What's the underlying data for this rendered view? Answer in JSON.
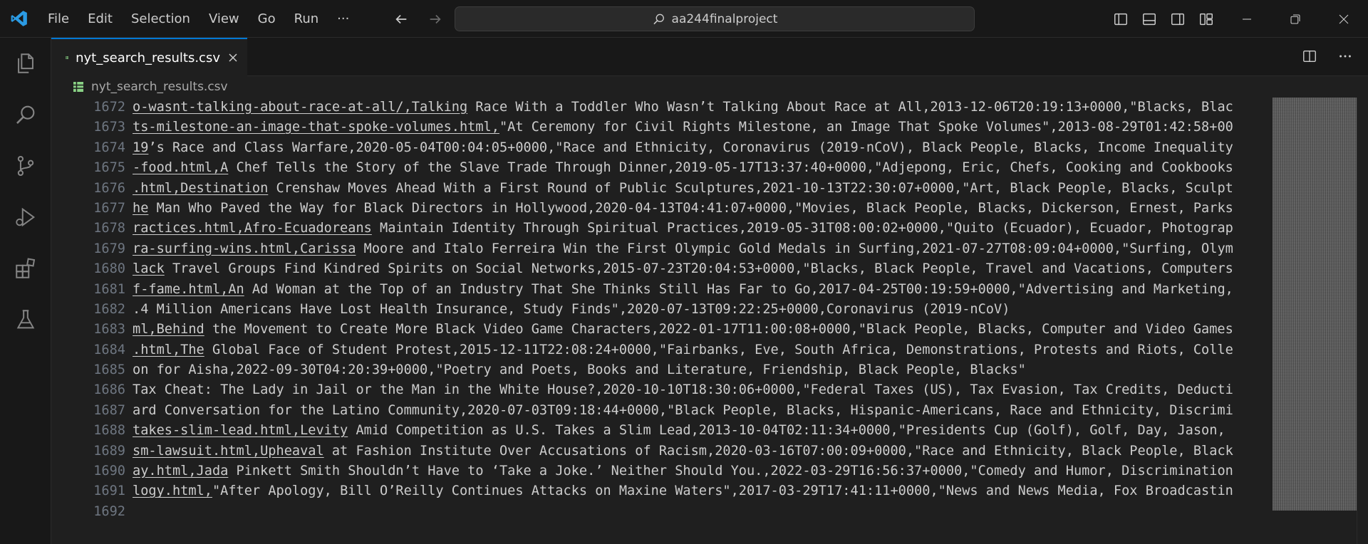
{
  "titlebar": {
    "menu": [
      "File",
      "Edit",
      "Selection",
      "View",
      "Go",
      "Run",
      "···"
    ],
    "search_text": "aa244finalproject"
  },
  "tab": {
    "label": "nyt_search_results.csv"
  },
  "breadcrumb": {
    "file": "nyt_search_results.csv"
  },
  "editor": {
    "lines": [
      {
        "n": "1672",
        "link": "o-wasnt-talking-about-race-at-all/,Talking",
        "rest": " Race With a Toddler Who Wasn’t Talking About Race at All,2013-12-06T20:19:13+0000,\"Blacks, Blac"
      },
      {
        "n": "1673",
        "link": "ts-milestone-an-image-that-spoke-volumes.html,",
        "rest": "\"At Ceremony for Civil Rights Milestone, an Image That Spoke Volumes\",2013-08-29T01:42:58+00"
      },
      {
        "n": "1674",
        "link": "19",
        "rest": "’s Race and Class Warfare,2020-05-04T00:04:05+0000,\"Race and Ethnicity, Coronavirus (2019-nCoV), Black People, Blacks, Income Inequality"
      },
      {
        "n": "1675",
        "link": "-food.html,A",
        "rest": " Chef Tells the Story of the Slave Trade Through Dinner,2019-05-17T13:37:40+0000,\"Adjepong, Eric, Chefs, Cooking and Cookbooks"
      },
      {
        "n": "1676",
        "link": ".html,Destination",
        "rest": " Crenshaw Moves Ahead With a First Round of Public Sculptures,2021-10-13T22:30:07+0000,\"Art, Black People, Blacks, Sculpt"
      },
      {
        "n": "1677",
        "link": "he",
        "rest": " Man Who Paved the Way for Black Directors in Hollywood,2020-04-13T04:41:07+0000,\"Movies, Black People, Blacks, Dickerson, Ernest, Parks"
      },
      {
        "n": "1678",
        "link": "ractices.html,Afro-Ecuadoreans",
        "rest": " Maintain Identity Through Spiritual Practices,2019-05-31T08:00:02+0000,\"Quito (Ecuador), Ecuador, Photograp"
      },
      {
        "n": "1679",
        "link": "ra-surfing-wins.html,Carissa",
        "rest": " Moore and Italo Ferreira Win the First Olympic Gold Medals in Surfing,2021-07-27T08:09:04+0000,\"Surfing, Olym"
      },
      {
        "n": "1680",
        "link": "lack",
        "rest": " Travel Groups Find Kindred Spirits on Social Networks,2015-07-23T20:04:53+0000,\"Blacks, Black People, Travel and Vacations, Computers"
      },
      {
        "n": "1681",
        "link": "f-fame.html,An",
        "rest": " Ad Woman at the Top of an Industry That She Thinks Still Has Far to Go,2017-04-25T00:19:59+0000,\"Advertising and Marketing,"
      },
      {
        "n": "1682",
        "link": "",
        "rest": ".4 Million Americans Have Lost Health Insurance, Study Finds\",2020-07-13T09:22:25+0000,Coronavirus (2019-nCoV)"
      },
      {
        "n": "1683",
        "link": "ml,Behind",
        "rest": " the Movement to Create More Black Video Game Characters,2022-01-17T11:00:08+0000,\"Black People, Blacks, Computer and Video Games"
      },
      {
        "n": "1684",
        "link": ".html,The",
        "rest": " Global Face of Student Protest,2015-12-11T22:08:24+0000,\"Fairbanks, Eve, South Africa, Demonstrations, Protests and Riots, Colle"
      },
      {
        "n": "1685",
        "link": "",
        "rest": "on for Aisha,2022-09-30T04:20:39+0000,\"Poetry and Poets, Books and Literature, Friendship, Black People, Blacks\""
      },
      {
        "n": "1686",
        "link": "",
        "rest": "Tax Cheat: The Lady in Jail or the Man in the White House?,2020-10-10T18:30:06+0000,\"Federal Taxes (US), Tax Evasion, Tax Credits, Deducti"
      },
      {
        "n": "1687",
        "link": "",
        "rest": "ard Conversation for the Latino Community,2020-07-03T09:18:44+0000,\"Black People, Blacks, Hispanic-Americans, Race and Ethnicity, Discrimi"
      },
      {
        "n": "1688",
        "link": "takes-slim-lead.html,Levity",
        "rest": " Amid Competition as U.S. Takes a Slim Lead,2013-10-04T02:11:34+0000,\"Presidents Cup (Golf), Golf, Day, Jason,"
      },
      {
        "n": "1689",
        "link": "sm-lawsuit.html,Upheaval",
        "rest": " at Fashion Institute Over Accusations of Racism,2020-03-16T07:00:09+0000,\"Race and Ethnicity, Black People, Black"
      },
      {
        "n": "1690",
        "link": "ay.html,Jada",
        "rest": " Pinkett Smith Shouldn’t Have to ‘Take a Joke.’ Neither Should You.,2022-03-29T16:56:37+0000,\"Comedy and Humor, Discrimination"
      },
      {
        "n": "1691",
        "link": "logy.html,",
        "rest": "\"After Apology, Bill O’Reilly Continues Attacks on Maxine Waters\",2017-03-29T17:41:11+0000,\"News and News Media, Fox Broadcastin"
      },
      {
        "n": "1692",
        "link": "",
        "rest": ""
      }
    ]
  }
}
